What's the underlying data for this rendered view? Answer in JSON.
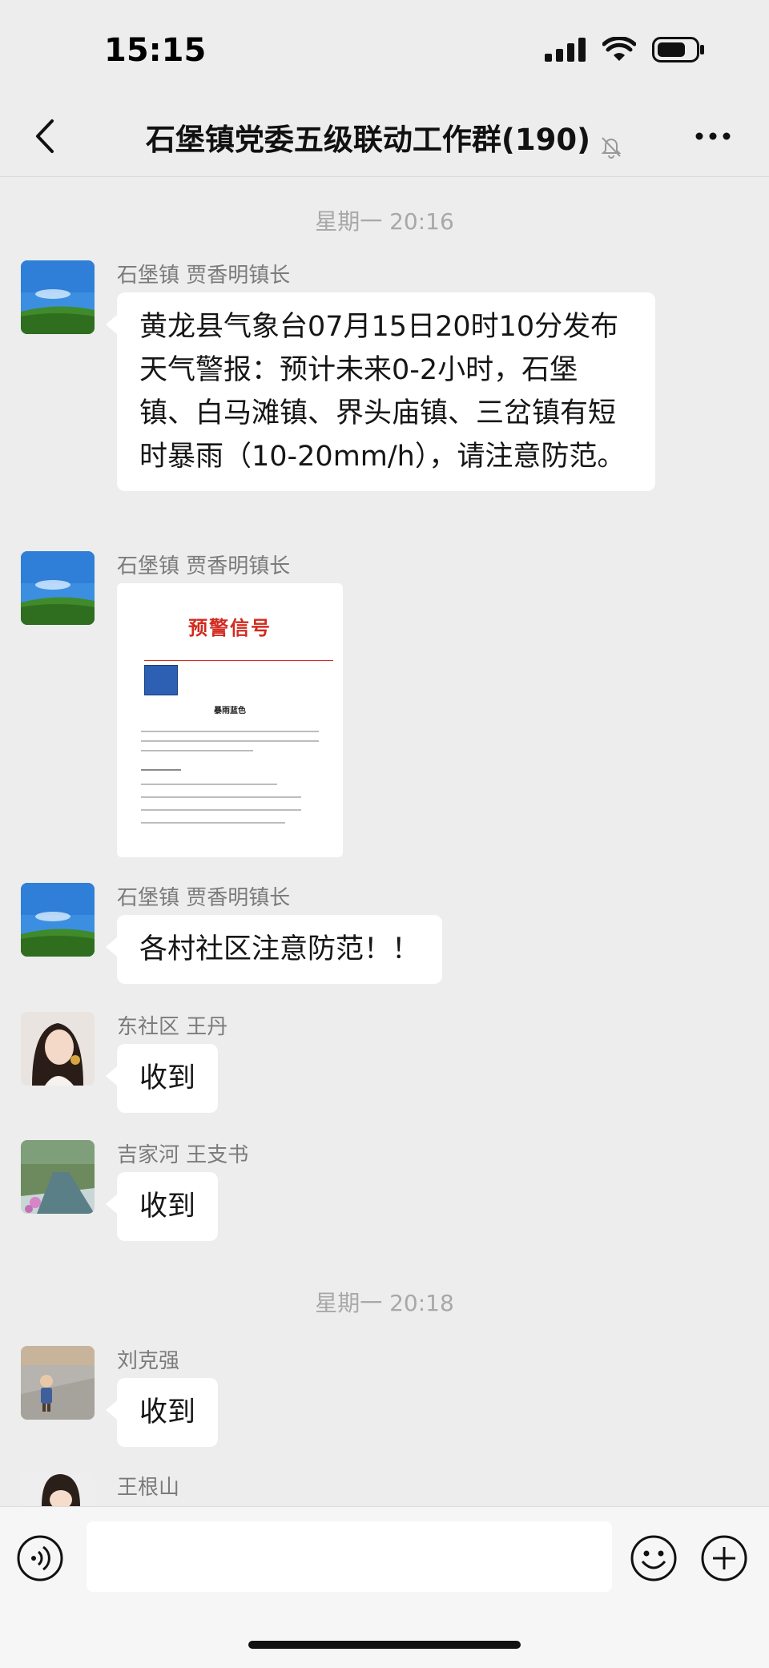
{
  "status_bar": {
    "time": "15:15",
    "icons": [
      "signal-icon",
      "wifi-icon",
      "battery-icon"
    ]
  },
  "header": {
    "title": "石堡镇党委五级联动工作群(190)",
    "icons": [
      "back-icon",
      "mute-bell-icon",
      "more-icon"
    ]
  },
  "messages": [
    {
      "timestamp": "星期一 20:16"
    },
    {
      "sender": "石堡镇 贾香明镇长",
      "avatar": "landscape-avatar",
      "text": "黄龙县气象台07月15日20时10分发布天气警报：预计未来0-2小时，石堡镇、白马滩镇、界头庙镇、三岔镇有短时暴雨（10-20mm/h），请注意防范。"
    },
    {
      "sender": "石堡镇 贾香明镇长",
      "avatar": "landscape-avatar",
      "image": {
        "title": "预警信号",
        "heading": "暴雨蓝色"
      }
    },
    {
      "sender": "石堡镇 贾香明镇长",
      "avatar": "landscape-avatar",
      "text": "各村社区注意防范！！"
    },
    {
      "sender": "东社区 王丹",
      "avatar": "woman-avatar",
      "text": "收到"
    },
    {
      "sender": "吉家河 王支书",
      "avatar": "river-avatar",
      "text": "收到"
    },
    {
      "timestamp": "星期一 20:18"
    },
    {
      "sender": "刘克强",
      "avatar": "child-avatar",
      "text": "收到"
    },
    {
      "sender": "王根山",
      "avatar": "girl-avatar"
    }
  ],
  "input_bar": {
    "icons": [
      "voice-icon",
      "emoji-icon",
      "plus-icon"
    ]
  },
  "colors": {
    "background": "#ededed",
    "bubble": "#ffffff",
    "alert_red": "#d22a1f"
  }
}
